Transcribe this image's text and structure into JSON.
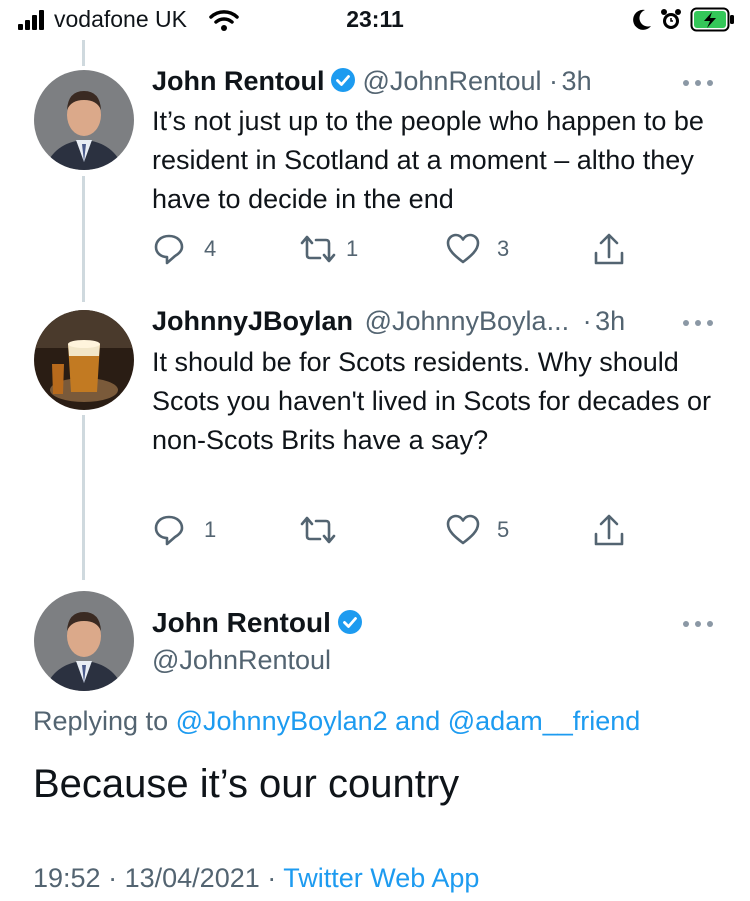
{
  "status_bar": {
    "carrier": "vodafone UK",
    "time": "23:11"
  },
  "tweets": [
    {
      "name": "John Rentoul",
      "handle": "@JohnRentoul",
      "separator": "·",
      "age": "3h",
      "text": "It’s not just up to the people who happen to be resident in Scotland at a moment – altho they have to decide in the end",
      "replies": "4",
      "retweets": "1",
      "likes": "3"
    },
    {
      "name": "JohnnyJBoylan",
      "handle": "@JohnnyBoyla...",
      "separator": "·",
      "age": "3h",
      "text": "It should be for Scots residents. Why should Scots you haven't lived in Scots for decades or non-Scots Brits have a say?",
      "replies": "1",
      "retweets": "",
      "likes": "5"
    }
  ],
  "main_tweet": {
    "name": "John Rentoul",
    "handle": "@JohnRentoul",
    "replying_prefix": "Replying to",
    "reply_to_1": "@JohnnyBoylan2",
    "reply_and": "and",
    "reply_to_2": "@adam__friend",
    "text": "Because it’s our country",
    "time": "19:52",
    "date": "13/04/2021",
    "separator": "·",
    "source": "Twitter Web App"
  },
  "colors": {
    "link": "#1d9bf0",
    "muted": "#536471",
    "verified": "#1d9bf0",
    "battery": "#34c759"
  }
}
